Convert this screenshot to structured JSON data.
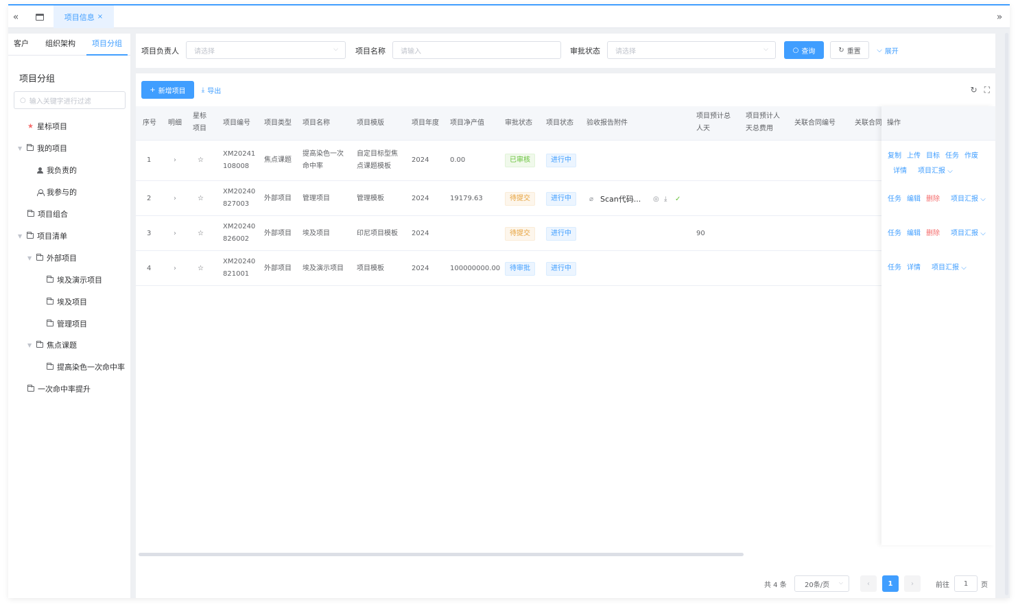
{
  "tabbar": {
    "tab_label": "项目信息",
    "close_glyph": "×"
  },
  "left": {
    "tabs": [
      "客户",
      "组织架构",
      "项目分组"
    ],
    "title": "项目分组",
    "search_placeholder": "输入关键字进行过滤",
    "tree": [
      "星标项目",
      "我的项目",
      "我负责的",
      "我参与的",
      "项目组合",
      "项目清单",
      "外部项目",
      "埃及演示项目",
      "埃及项目",
      "管理项目",
      "焦点课题",
      "提高染色一次命中率",
      "一次命中率提升"
    ]
  },
  "filter": {
    "owner_label": "项目负责人",
    "owner_placeholder": "请选择",
    "name_label": "项目名称",
    "name_placeholder": "请输入",
    "status_label": "审批状态",
    "status_placeholder": "请选择",
    "query": "查询",
    "reset": "重置",
    "expand": "展开"
  },
  "toolbar": {
    "add": "新增项目",
    "export": "导出"
  },
  "table": {
    "headers": {
      "seq": "序号",
      "detail": "明细",
      "star1": "星标",
      "star2": "项目",
      "code": "项目编号",
      "type": "项目类型",
      "name": "项目名称",
      "template": "项目模版",
      "year": "项目年度",
      "output": "项目净产值",
      "approval": "审批状态",
      "status": "项目状态",
      "attach": "验收报告附件",
      "days1": "项目预计总",
      "days2": "人天",
      "cost1": "项目预计人",
      "cost2": "天总费用",
      "contract": "关联合同编号",
      "contract2": "关联合同",
      "ops": "操作"
    },
    "rows": [
      {
        "seq": "1",
        "code1": "XM20241",
        "code2": "108008",
        "type": "焦点课题",
        "name1": "提高染色一次",
        "name2": "命中率",
        "tpl1": "自定目标型焦",
        "tpl2": "点课题模板",
        "year": "2024",
        "output": "0.00",
        "approval": "已审核",
        "status": "进行中",
        "attach": "",
        "days": "",
        "ops": [
          "复制",
          "上传",
          "目标",
          "任务",
          "作废",
          "详情",
          "项目汇报"
        ]
      },
      {
        "seq": "2",
        "code1": "XM20240",
        "code2": "827003",
        "type": "外部项目",
        "name1": "管理项目",
        "tpl1": "管理模板",
        "year": "2024",
        "output": "19179.63",
        "approval": "待提交",
        "status": "进行中",
        "attach": "Scan代码...",
        "days": "",
        "ops": [
          "任务",
          "编辑",
          "删除",
          "项目汇报"
        ]
      },
      {
        "seq": "3",
        "code1": "XM20240",
        "code2": "826002",
        "type": "外部项目",
        "name1": "埃及项目",
        "tpl1": "印尼项目模板",
        "year": "2024",
        "output": "",
        "approval": "待提交",
        "status": "进行中",
        "attach": "",
        "days": "90",
        "ops": [
          "任务",
          "编辑",
          "删除",
          "项目汇报"
        ]
      },
      {
        "seq": "4",
        "code1": "XM20240",
        "code2": "821001",
        "type": "外部项目",
        "name1": "埃及演示项目",
        "tpl1": "项目模板",
        "year": "2024",
        "output": "100000000.00",
        "approval": "待审批",
        "status": "进行中",
        "attach": "",
        "days": "",
        "ops": [
          "任务",
          "详情",
          "项目汇报"
        ]
      }
    ]
  },
  "pager": {
    "total": "共 4 条",
    "size": "20条/页",
    "page": "1",
    "goto": "前往",
    "goto_value": "1",
    "unit": "页"
  },
  "colors": {
    "primary": "#409eff",
    "danger": "#f56c6c",
    "success": "#67c23a",
    "warning": "#e6a23c"
  }
}
